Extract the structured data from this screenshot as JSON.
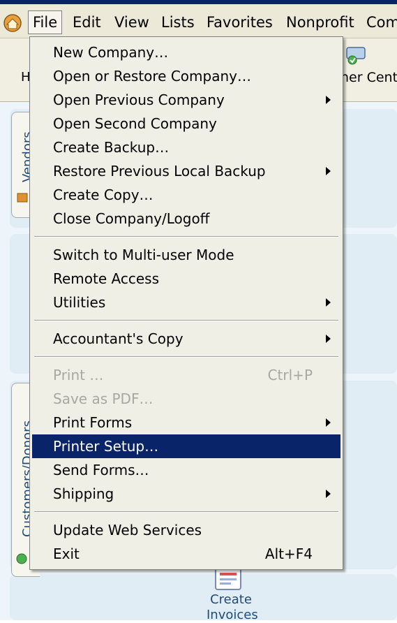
{
  "menubar": {
    "items": [
      "File",
      "Edit",
      "View",
      "Lists",
      "Favorites",
      "Nonprofit",
      "Comp"
    ]
  },
  "toolbar": {
    "left_label": "H",
    "right_label": "ner Cent",
    "right_icon": "customer-center-icon"
  },
  "sidebar": {
    "vendors_tab": "Vendors",
    "customers_tab": "Customers/Donors"
  },
  "home": {
    "create_invoices_line1": "Create",
    "create_invoices_line2": "Invoices",
    "create_invoices_icon": "invoice-icon"
  },
  "file_menu": {
    "items": [
      {
        "label": "New Company…",
        "shortcut": "",
        "submenu": false,
        "disabled": false,
        "highlighted": false
      },
      {
        "label": "Open or Restore Company…",
        "shortcut": "",
        "submenu": false,
        "disabled": false,
        "highlighted": false
      },
      {
        "label": "Open Previous Company",
        "shortcut": "",
        "submenu": true,
        "disabled": false,
        "highlighted": false
      },
      {
        "label": "Open Second Company",
        "shortcut": "",
        "submenu": false,
        "disabled": false,
        "highlighted": false
      },
      {
        "label": "Create Backup…",
        "shortcut": "",
        "submenu": false,
        "disabled": false,
        "highlighted": false
      },
      {
        "label": "Restore Previous Local Backup",
        "shortcut": "",
        "submenu": true,
        "disabled": false,
        "highlighted": false
      },
      {
        "label": "Create Copy…",
        "shortcut": "",
        "submenu": false,
        "disabled": false,
        "highlighted": false
      },
      {
        "label": "Close Company/Logoff",
        "shortcut": "",
        "submenu": false,
        "disabled": false,
        "highlighted": false
      },
      {
        "label": "Switch to Multi-user Mode",
        "shortcut": "",
        "submenu": false,
        "disabled": false,
        "highlighted": false
      },
      {
        "label": "Remote Access",
        "shortcut": "",
        "submenu": false,
        "disabled": false,
        "highlighted": false
      },
      {
        "label": "Utilities",
        "shortcut": "",
        "submenu": true,
        "disabled": false,
        "highlighted": false
      },
      {
        "label": "Accountant's Copy",
        "shortcut": "",
        "submenu": true,
        "disabled": false,
        "highlighted": false
      },
      {
        "label": "Print …",
        "shortcut": "Ctrl+P",
        "submenu": false,
        "disabled": true,
        "highlighted": false
      },
      {
        "label": "Save as PDF…",
        "shortcut": "",
        "submenu": false,
        "disabled": true,
        "highlighted": false
      },
      {
        "label": "Print Forms",
        "shortcut": "",
        "submenu": true,
        "disabled": false,
        "highlighted": false
      },
      {
        "label": "Printer Setup…",
        "shortcut": "",
        "submenu": false,
        "disabled": false,
        "highlighted": true
      },
      {
        "label": "Send Forms…",
        "shortcut": "",
        "submenu": false,
        "disabled": false,
        "highlighted": false
      },
      {
        "label": "Shipping",
        "shortcut": "",
        "submenu": true,
        "disabled": false,
        "highlighted": false
      },
      {
        "label": "Update Web Services",
        "shortcut": "",
        "submenu": false,
        "disabled": false,
        "highlighted": false
      },
      {
        "label": "Exit",
        "shortcut": "Alt+F4",
        "submenu": false,
        "disabled": false,
        "highlighted": false
      }
    ]
  },
  "colors": {
    "highlight": "#0a246a",
    "menu_bg": "#f0efe6",
    "disabled_text": "#a8a8a0"
  }
}
